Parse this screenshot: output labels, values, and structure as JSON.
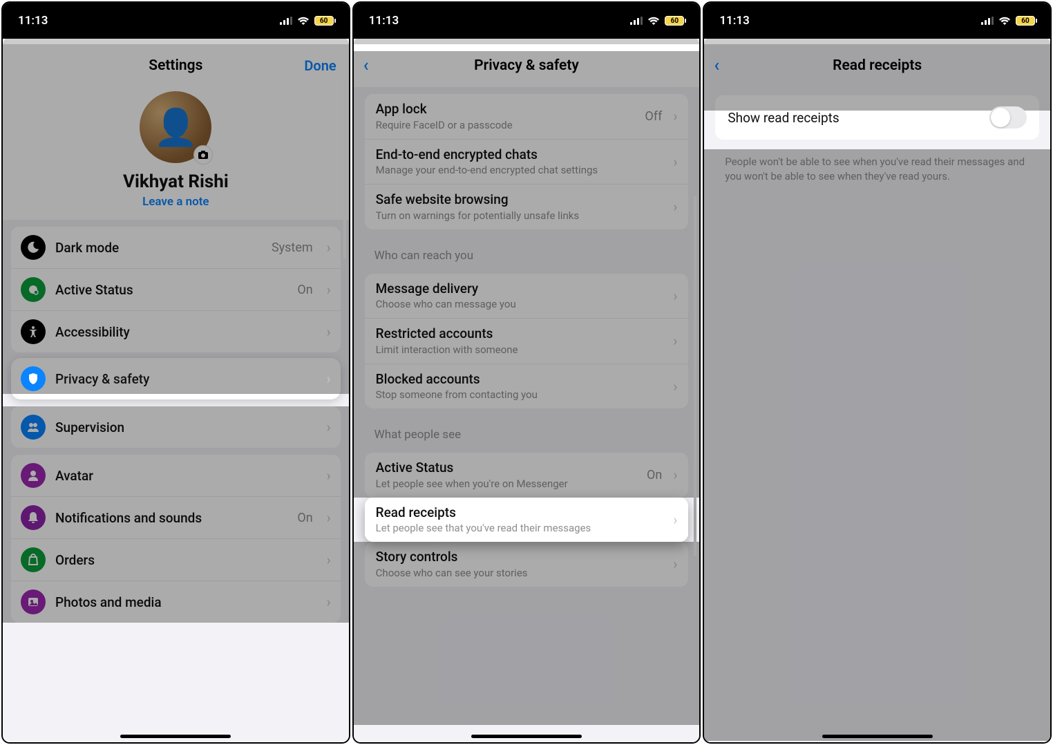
{
  "statusbar": {
    "time": "11:13",
    "battery": "60"
  },
  "phone1": {
    "title": "Settings",
    "done": "Done",
    "profile": {
      "name": "Vikhyat Rishi",
      "note": "Leave a note"
    },
    "rows": {
      "dark_mode": {
        "label": "Dark mode",
        "value": "System"
      },
      "active_status": {
        "label": "Active Status",
        "value": "On"
      },
      "accessibility": {
        "label": "Accessibility"
      },
      "privacy_safety": {
        "label": "Privacy & safety"
      },
      "supervision": {
        "label": "Supervision"
      },
      "avatar": {
        "label": "Avatar"
      },
      "notifications": {
        "label": "Notifications and sounds",
        "value": "On"
      },
      "orders": {
        "label": "Orders"
      },
      "photos_media": {
        "label": "Photos and media"
      }
    }
  },
  "phone2": {
    "title": "Privacy & safety",
    "rows": {
      "app_lock": {
        "title": "App lock",
        "sub": "Require FaceID or a passcode",
        "value": "Off"
      },
      "e2e": {
        "title": "End-to-end encrypted chats",
        "sub": "Manage your end-to-end encrypted chat settings"
      },
      "safe_browsing": {
        "title": "Safe website browsing",
        "sub": "Turn on warnings for potentially unsafe links"
      },
      "message_delivery": {
        "title": "Message delivery",
        "sub": "Choose who can message you"
      },
      "restricted": {
        "title": "Restricted accounts",
        "sub": "Limit interaction with someone"
      },
      "blocked": {
        "title": "Blocked accounts",
        "sub": "Stop someone from contacting you"
      },
      "active_status": {
        "title": "Active Status",
        "sub": "Let people see when you're on Messenger",
        "value": "On"
      },
      "read_receipts": {
        "title": "Read receipts",
        "sub": "Let people see that you've read their messages"
      },
      "story_controls": {
        "title": "Story controls",
        "sub": "Choose who can see your stories"
      }
    },
    "sections": {
      "who_can_reach": "Who can reach you",
      "what_people_see": "What people see"
    }
  },
  "phone3": {
    "title": "Read receipts",
    "toggle_label": "Show read receipts",
    "footer": "People won't be able to see when you've read their messages and you won't be able to see when they've read yours."
  }
}
